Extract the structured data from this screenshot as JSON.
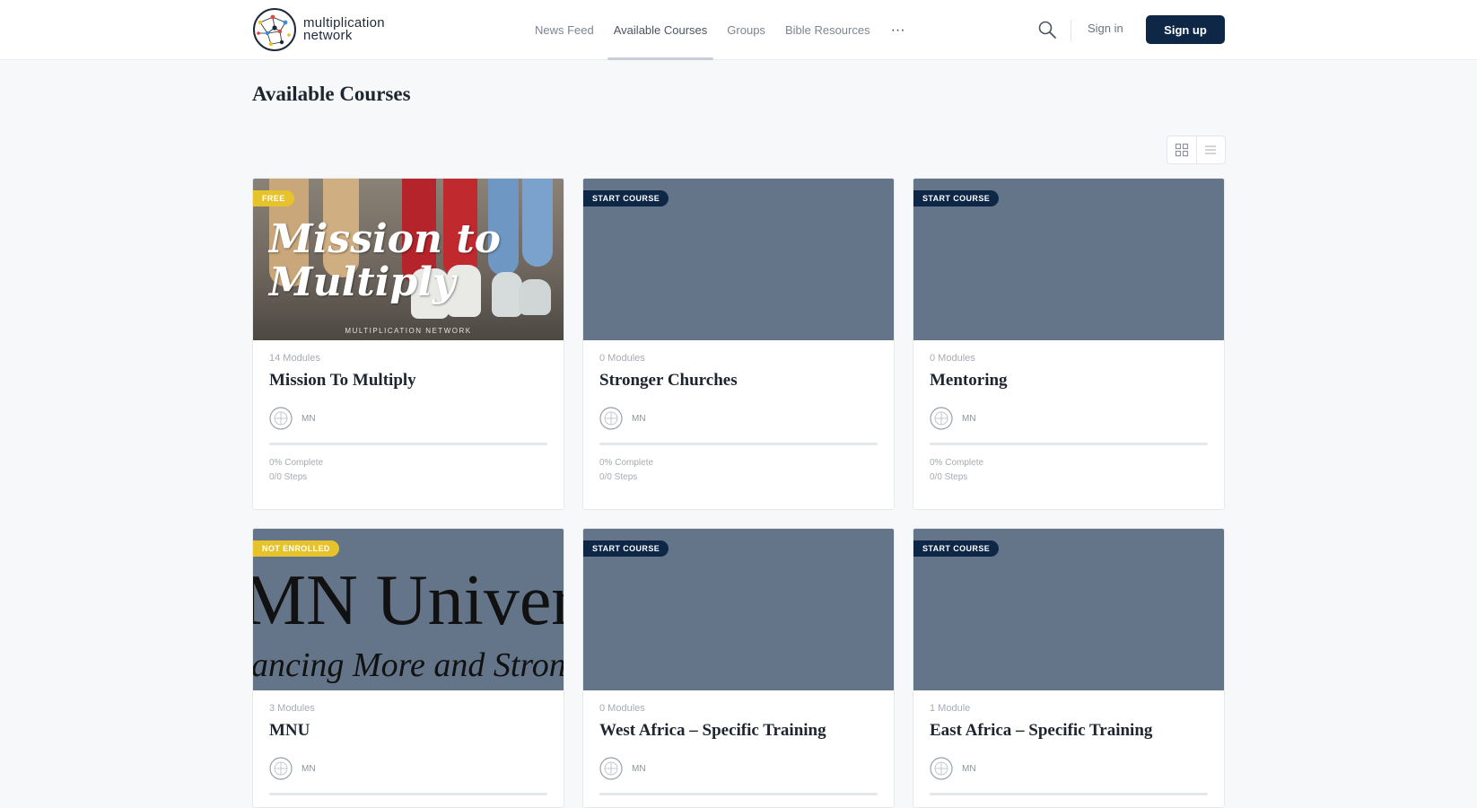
{
  "header": {
    "logo_line1": "multiplication",
    "logo_line2": "network",
    "nav": [
      {
        "label": "News Feed"
      },
      {
        "label": "Available Courses",
        "active": true
      },
      {
        "label": "Groups"
      },
      {
        "label": "Bible Resources"
      }
    ],
    "more_label": "···",
    "sign_in": "Sign in",
    "sign_up": "Sign up",
    "search_icon": "search-icon"
  },
  "page": {
    "title": "Available Courses"
  },
  "colors": {
    "brand_dark": "#0f2746",
    "badge_yellow": "#e6c22b",
    "thumb_placeholder": "#64758a"
  },
  "courses": [
    {
      "badge": "Free",
      "modules": "14 Modules",
      "title": "Mission To Multiply",
      "author": "MN",
      "complete": "0% Complete",
      "steps": "0/0 Steps",
      "thumb_text1": "Mission to",
      "thumb_text2": "Multiply",
      "thumb_footer": "MULTIPLICATION NETWORK"
    },
    {
      "badge": "Start Course",
      "modules": "0 Modules",
      "title": "Stronger Churches",
      "author": "MN",
      "complete": "0% Complete",
      "steps": "0/0 Steps"
    },
    {
      "badge": "Start Course",
      "modules": "0 Modules",
      "title": "Mentoring",
      "author": "MN",
      "complete": "0% Complete",
      "steps": "0/0 Steps"
    },
    {
      "badge": "Not Enrolled",
      "modules": "3 Modules",
      "title": "MNU",
      "author": "MN",
      "thumb_text1": "MN Univer",
      "thumb_text2": "ancing More and Stron"
    },
    {
      "badge": "Start Course",
      "modules": "0 Modules",
      "title": "West Africa – Specific Training",
      "author": "MN"
    },
    {
      "badge": "Start Course",
      "modules": "1 Module",
      "title": "East Africa – Specific Training",
      "author": "MN"
    }
  ]
}
